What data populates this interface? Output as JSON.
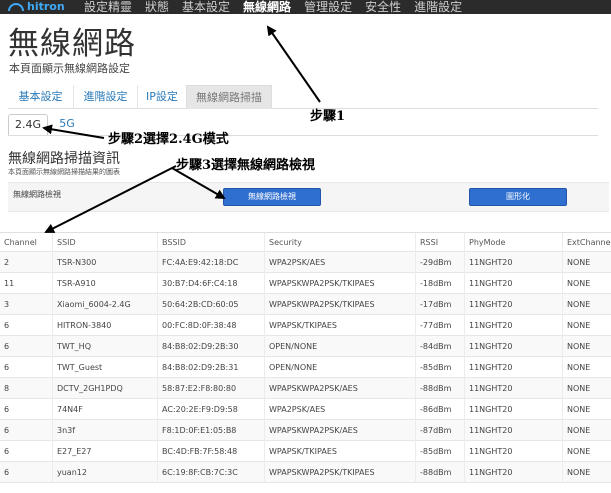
{
  "nav": {
    "logo_text": "hitron",
    "items": [
      {
        "label": "設定精靈",
        "active": false
      },
      {
        "label": "狀態",
        "active": false
      },
      {
        "label": "基本設定",
        "active": false
      },
      {
        "label": "無線網路",
        "active": true
      },
      {
        "label": "管理設定",
        "active": false
      },
      {
        "label": "安全性",
        "active": false
      },
      {
        "label": "進階設定",
        "active": false
      }
    ]
  },
  "page": {
    "title": "無線網路",
    "subtitle": "本頁面顯示無線網路設定"
  },
  "tabs": {
    "main": [
      "基本設定",
      "進階設定",
      "IP設定",
      "無線網路掃描"
    ],
    "main_active": "無線網路掃描",
    "band": [
      "2.4G",
      "5G"
    ],
    "band_active": "2.4G"
  },
  "section": {
    "title": "無線網路掃描資訊",
    "description": "本頁面顯示無線網路掃描結果的圖表",
    "scan_label": "無線網路檢視",
    "scan_button": "無線網路檢視",
    "graph_button": "圖形化"
  },
  "table": {
    "headers": [
      "Channel",
      "SSID",
      "BSSID",
      "Security",
      "RSSI",
      "PhyMode",
      "ExtChannel"
    ],
    "rows": [
      [
        "2",
        "TSR-N300",
        "FC:4A:E9:42:18:DC",
        "WPA2PSK/AES",
        "-29dBm",
        "11NGHT20",
        "NONE"
      ],
      [
        "11",
        "TSR-A910",
        "30:B7:D4:6F:C4:18",
        "WPAPSKWPA2PSK/TKIPAES",
        "-18dBm",
        "11NGHT20",
        "NONE"
      ],
      [
        "3",
        "Xiaomi_6004-2.4G",
        "50:64:2B:CD:60:05",
        "WPAPSKWPA2PSK/TKIPAES",
        "-17dBm",
        "11NGHT20",
        "NONE"
      ],
      [
        "6",
        "HITRON-3840",
        "00:FC:8D:0F:38:48",
        "WPAPSK/TKIPAES",
        "-77dBm",
        "11NGHT20",
        "NONE"
      ],
      [
        "6",
        "TWT_HQ",
        "84:B8:02:D9:2B:30",
        "OPEN/NONE",
        "-84dBm",
        "11NGHT20",
        "NONE"
      ],
      [
        "6",
        "TWT_Guest",
        "84:B8:02:D9:2B:31",
        "OPEN/NONE",
        "-85dBm",
        "11NGHT20",
        "NONE"
      ],
      [
        "8",
        "DCTV_2GH1PDQ",
        "58:87:E2:F8:80:80",
        "WPAPSKWPA2PSK/AES",
        "-88dBm",
        "11NGHT20",
        "NONE"
      ],
      [
        "6",
        "74N4F",
        "AC:20:2E:F9:D9:58",
        "WPA2PSK/AES",
        "-86dBm",
        "11NGHT20",
        "NONE"
      ],
      [
        "6",
        "3n3f",
        "F8:1D:0F:E1:05:B8",
        "WPAPSKWPA2PSK/AES",
        "-87dBm",
        "11NGHT20",
        "NONE"
      ],
      [
        "6",
        "E27_E27",
        "BC:4D:FB:7F:58:48",
        "WPAPSK/TKIPAES",
        "-85dBm",
        "11NGHT20",
        "NONE"
      ],
      [
        "6",
        "yuan12",
        "6C:19:8F:CB:7C:3C",
        "WPAPSKWPA2PSK/TKIPAES",
        "-88dBm",
        "11NGHT20",
        "NONE"
      ]
    ]
  },
  "annotations": {
    "step1": "步驟1",
    "step2": "步驟2選擇2.4G模式",
    "step3": "步驟3選擇無線網路檢視"
  },
  "colors": {
    "nav_bg": "#2b2b2b",
    "accent_blue": "#2f6fd0",
    "link_blue": "#2a7ab8",
    "logo_blue": "#3fa9f5"
  },
  "icons": {
    "logo": "hitron-arc-logo",
    "arrows": "annotation-arrow"
  }
}
